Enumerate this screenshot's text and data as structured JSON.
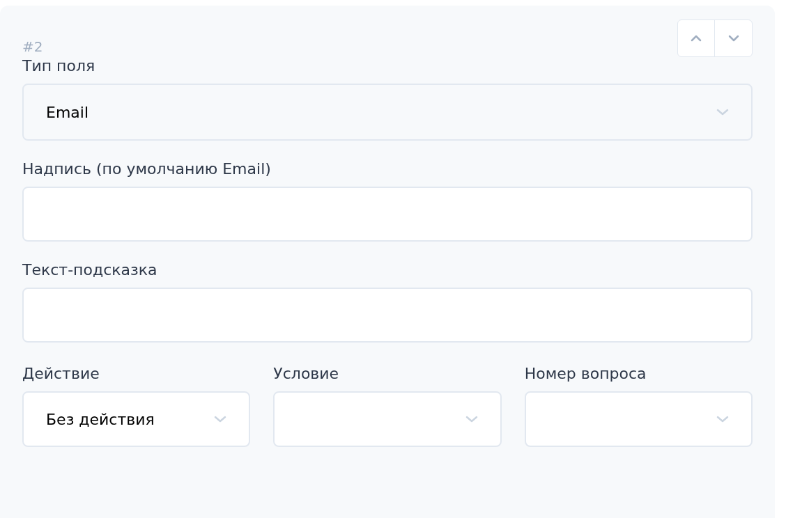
{
  "item_number": "#2",
  "fields": [
    {
      "kind": "select",
      "label": "Тип поля",
      "value": "Email"
    },
    {
      "kind": "text",
      "label": "Надпись (по умолчанию Email)"
    },
    {
      "kind": "text",
      "label": "Текст-подсказка"
    }
  ],
  "logic_fields": [
    {
      "kind": "select",
      "label": "Действие",
      "value": "Без действия"
    },
    {
      "kind": "select",
      "label": "Условие"
    },
    {
      "kind": "select",
      "label": "Номер вопроса"
    }
  ]
}
